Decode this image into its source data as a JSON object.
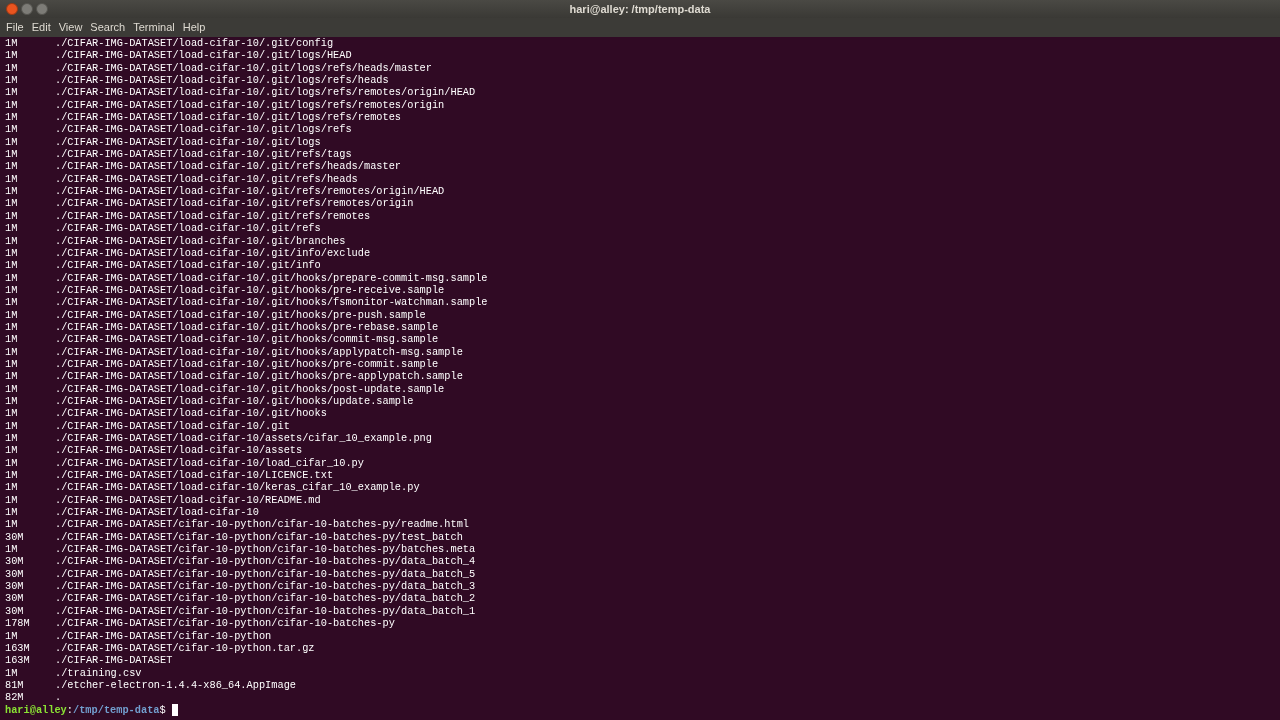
{
  "window": {
    "title": "hari@alley: /tmp/temp-data"
  },
  "menu": [
    "File",
    "Edit",
    "View",
    "Search",
    "Terminal",
    "Help"
  ],
  "lines": [
    {
      "size": "1M",
      "path": "./CIFAR-IMG-DATASET/load-cifar-10/.git/config"
    },
    {
      "size": "1M",
      "path": "./CIFAR-IMG-DATASET/load-cifar-10/.git/logs/HEAD"
    },
    {
      "size": "1M",
      "path": "./CIFAR-IMG-DATASET/load-cifar-10/.git/logs/refs/heads/master"
    },
    {
      "size": "1M",
      "path": "./CIFAR-IMG-DATASET/load-cifar-10/.git/logs/refs/heads"
    },
    {
      "size": "1M",
      "path": "./CIFAR-IMG-DATASET/load-cifar-10/.git/logs/refs/remotes/origin/HEAD"
    },
    {
      "size": "1M",
      "path": "./CIFAR-IMG-DATASET/load-cifar-10/.git/logs/refs/remotes/origin"
    },
    {
      "size": "1M",
      "path": "./CIFAR-IMG-DATASET/load-cifar-10/.git/logs/refs/remotes"
    },
    {
      "size": "1M",
      "path": "./CIFAR-IMG-DATASET/load-cifar-10/.git/logs/refs"
    },
    {
      "size": "1M",
      "path": "./CIFAR-IMG-DATASET/load-cifar-10/.git/logs"
    },
    {
      "size": "1M",
      "path": "./CIFAR-IMG-DATASET/load-cifar-10/.git/refs/tags"
    },
    {
      "size": "1M",
      "path": "./CIFAR-IMG-DATASET/load-cifar-10/.git/refs/heads/master"
    },
    {
      "size": "1M",
      "path": "./CIFAR-IMG-DATASET/load-cifar-10/.git/refs/heads"
    },
    {
      "size": "1M",
      "path": "./CIFAR-IMG-DATASET/load-cifar-10/.git/refs/remotes/origin/HEAD"
    },
    {
      "size": "1M",
      "path": "./CIFAR-IMG-DATASET/load-cifar-10/.git/refs/remotes/origin"
    },
    {
      "size": "1M",
      "path": "./CIFAR-IMG-DATASET/load-cifar-10/.git/refs/remotes"
    },
    {
      "size": "1M",
      "path": "./CIFAR-IMG-DATASET/load-cifar-10/.git/refs"
    },
    {
      "size": "1M",
      "path": "./CIFAR-IMG-DATASET/load-cifar-10/.git/branches"
    },
    {
      "size": "1M",
      "path": "./CIFAR-IMG-DATASET/load-cifar-10/.git/info/exclude"
    },
    {
      "size": "1M",
      "path": "./CIFAR-IMG-DATASET/load-cifar-10/.git/info"
    },
    {
      "size": "1M",
      "path": "./CIFAR-IMG-DATASET/load-cifar-10/.git/hooks/prepare-commit-msg.sample"
    },
    {
      "size": "1M",
      "path": "./CIFAR-IMG-DATASET/load-cifar-10/.git/hooks/pre-receive.sample"
    },
    {
      "size": "1M",
      "path": "./CIFAR-IMG-DATASET/load-cifar-10/.git/hooks/fsmonitor-watchman.sample"
    },
    {
      "size": "1M",
      "path": "./CIFAR-IMG-DATASET/load-cifar-10/.git/hooks/pre-push.sample"
    },
    {
      "size": "1M",
      "path": "./CIFAR-IMG-DATASET/load-cifar-10/.git/hooks/pre-rebase.sample"
    },
    {
      "size": "1M",
      "path": "./CIFAR-IMG-DATASET/load-cifar-10/.git/hooks/commit-msg.sample"
    },
    {
      "size": "1M",
      "path": "./CIFAR-IMG-DATASET/load-cifar-10/.git/hooks/applypatch-msg.sample"
    },
    {
      "size": "1M",
      "path": "./CIFAR-IMG-DATASET/load-cifar-10/.git/hooks/pre-commit.sample"
    },
    {
      "size": "1M",
      "path": "./CIFAR-IMG-DATASET/load-cifar-10/.git/hooks/pre-applypatch.sample"
    },
    {
      "size": "1M",
      "path": "./CIFAR-IMG-DATASET/load-cifar-10/.git/hooks/post-update.sample"
    },
    {
      "size": "1M",
      "path": "./CIFAR-IMG-DATASET/load-cifar-10/.git/hooks/update.sample"
    },
    {
      "size": "1M",
      "path": "./CIFAR-IMG-DATASET/load-cifar-10/.git/hooks"
    },
    {
      "size": "1M",
      "path": "./CIFAR-IMG-DATASET/load-cifar-10/.git"
    },
    {
      "size": "1M",
      "path": "./CIFAR-IMG-DATASET/load-cifar-10/assets/cifar_10_example.png"
    },
    {
      "size": "1M",
      "path": "./CIFAR-IMG-DATASET/load-cifar-10/assets"
    },
    {
      "size": "1M",
      "path": "./CIFAR-IMG-DATASET/load-cifar-10/load_cifar_10.py"
    },
    {
      "size": "1M",
      "path": "./CIFAR-IMG-DATASET/load-cifar-10/LICENCE.txt"
    },
    {
      "size": "1M",
      "path": "./CIFAR-IMG-DATASET/load-cifar-10/keras_cifar_10_example.py"
    },
    {
      "size": "1M",
      "path": "./CIFAR-IMG-DATASET/load-cifar-10/README.md"
    },
    {
      "size": "1M",
      "path": "./CIFAR-IMG-DATASET/load-cifar-10"
    },
    {
      "size": "1M",
      "path": "./CIFAR-IMG-DATASET/cifar-10-python/cifar-10-batches-py/readme.html"
    },
    {
      "size": "30M",
      "path": "./CIFAR-IMG-DATASET/cifar-10-python/cifar-10-batches-py/test_batch"
    },
    {
      "size": "1M",
      "path": "./CIFAR-IMG-DATASET/cifar-10-python/cifar-10-batches-py/batches.meta"
    },
    {
      "size": "30M",
      "path": "./CIFAR-IMG-DATASET/cifar-10-python/cifar-10-batches-py/data_batch_4"
    },
    {
      "size": "30M",
      "path": "./CIFAR-IMG-DATASET/cifar-10-python/cifar-10-batches-py/data_batch_5"
    },
    {
      "size": "30M",
      "path": "./CIFAR-IMG-DATASET/cifar-10-python/cifar-10-batches-py/data_batch_3"
    },
    {
      "size": "30M",
      "path": "./CIFAR-IMG-DATASET/cifar-10-python/cifar-10-batches-py/data_batch_2"
    },
    {
      "size": "30M",
      "path": "./CIFAR-IMG-DATASET/cifar-10-python/cifar-10-batches-py/data_batch_1"
    },
    {
      "size": "178M",
      "path": "./CIFAR-IMG-DATASET/cifar-10-python/cifar-10-batches-py"
    },
    {
      "size": "1M",
      "path": "./CIFAR-IMG-DATASET/cifar-10-python"
    },
    {
      "size": "163M",
      "path": "./CIFAR-IMG-DATASET/cifar-10-python.tar.gz"
    },
    {
      "size": "163M",
      "path": "./CIFAR-IMG-DATASET"
    },
    {
      "size": "1M",
      "path": "./training.csv"
    },
    {
      "size": "81M",
      "path": "./etcher-electron-1.4.4-x86_64.AppImage"
    },
    {
      "size": "82M",
      "path": "."
    }
  ],
  "prompt": {
    "user_host": "hari@alley",
    "separator": ":",
    "cwd": "/tmp/temp-data",
    "symbol": "$"
  }
}
